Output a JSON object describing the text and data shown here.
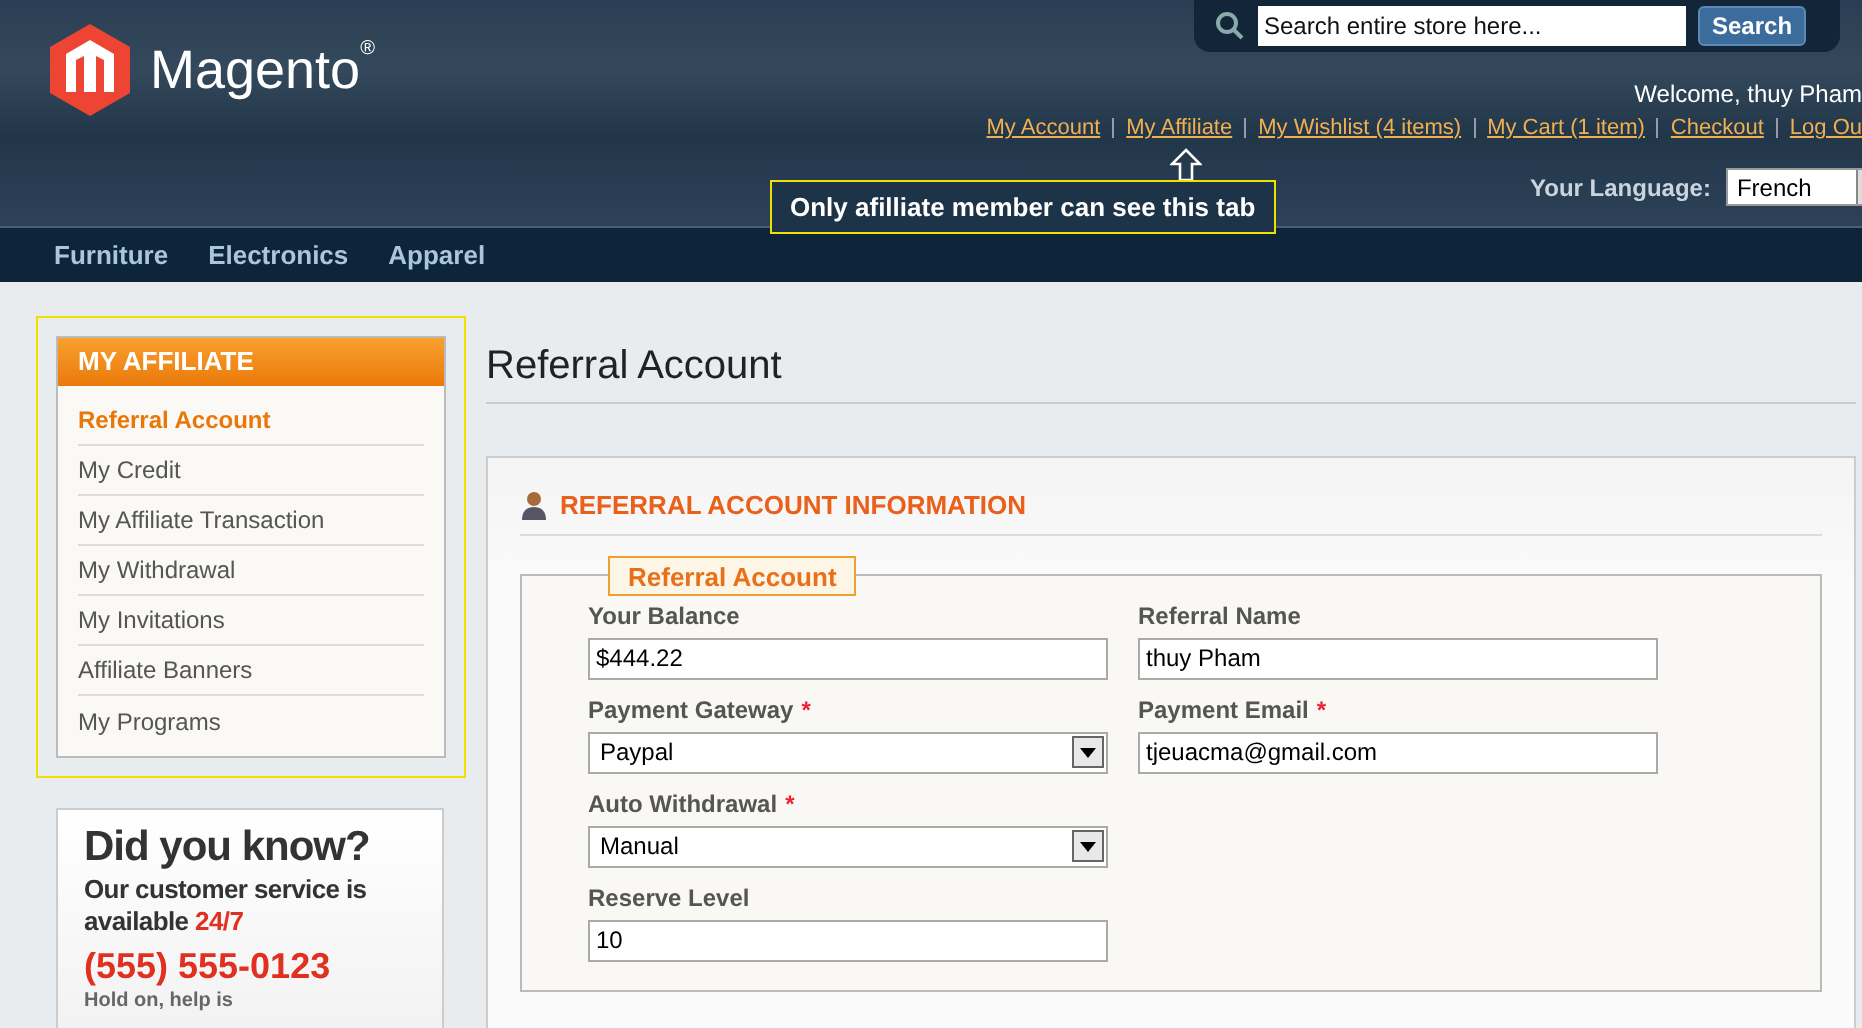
{
  "header": {
    "logo_text": "Magento",
    "logo_mark": "®",
    "search": {
      "placeholder": "Search entire store here...",
      "button": "Search"
    },
    "welcome": "Welcome, thuy Pham",
    "links": [
      {
        "label": "My Account"
      },
      {
        "label": "My Affiliate"
      },
      {
        "label": "My Wishlist (4 items)"
      },
      {
        "label": "My Cart (1 item)"
      },
      {
        "label": "Checkout"
      },
      {
        "label": "Log Ou"
      }
    ],
    "callout": "Only afilliate member can see this tab",
    "language_label": "Your Language:",
    "language_value": "French"
  },
  "nav": [
    {
      "label": "Furniture"
    },
    {
      "label": "Electronics"
    },
    {
      "label": "Apparel"
    }
  ],
  "sidebar": {
    "title": "MY AFFILIATE",
    "items": [
      {
        "label": "Referral Account",
        "selected": true
      },
      {
        "label": "My Credit",
        "selected": false
      },
      {
        "label": "My Affiliate Transaction",
        "selected": false
      },
      {
        "label": "My Withdrawal",
        "selected": false
      },
      {
        "label": "My Invitations",
        "selected": false
      },
      {
        "label": "Affiliate Banners",
        "selected": false
      },
      {
        "label": "My Programs",
        "selected": false
      }
    ]
  },
  "promo": {
    "title": "Did you know?",
    "line": "Our customer service is available **24/7**",
    "phone": "(555) 555-0123",
    "note": "Hold on, help is"
  },
  "page_title": "Referral Account",
  "section": {
    "required_mark": "*",
    "title": "REFERRAL ACCOUNT INFORMATION",
    "legend": "Referral Account",
    "columns": [
      [
        {
          "label": "Your Balance",
          "kind": "text",
          "required": false,
          "value": "$444.22"
        },
        {
          "label": "Payment Gateway",
          "kind": "select",
          "required": true,
          "value": "Paypal"
        },
        {
          "label": "Auto Withdrawal",
          "kind": "select",
          "required": true,
          "value": "Manual"
        },
        {
          "label": "Reserve Level",
          "kind": "text",
          "required": false,
          "value": "10"
        }
      ],
      [
        {
          "label": "Referral Name",
          "kind": "text",
          "required": false,
          "value": "thuy Pham"
        },
        {
          "label": "Payment Email",
          "kind": "text",
          "required": true,
          "value": "tjeuacma@gmail.com"
        }
      ]
    ]
  }
}
